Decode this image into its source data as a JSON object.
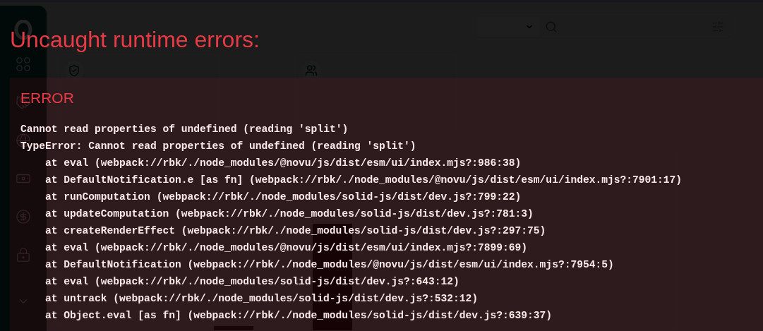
{
  "overlay": {
    "title": "Uncaught runtime errors:",
    "errors": [
      {
        "label": "ERROR",
        "message": "Cannot read properties of undefined (reading 'split')",
        "stack": [
          "TypeError: Cannot read properties of undefined (reading 'split')",
          "at eval (webpack://rbk/./node_modules/@novu/js/dist/esm/ui/index.mjs?:986:38)",
          "at DefaultNotification.e [as fn] (webpack://rbk/./node_modules/@novu/js/dist/esm/ui/index.mjs?:7901:17)",
          "at runComputation (webpack://rbk/./node_modules/solid-js/dist/dev.js?:799:22)",
          "at updateComputation (webpack://rbk/./node_modules/solid-js/dist/dev.js?:781:3)",
          "at createRenderEffect (webpack://rbk/./node_modules/solid-js/dist/dev.js?:297:75)",
          "at eval (webpack://rbk/./node_modules/@novu/js/dist/esm/ui/index.mjs?:7899:69)",
          "at DefaultNotification (webpack://rbk/./node_modules/@novu/js/dist/esm/ui/index.mjs?:7954:5)",
          "at eval (webpack://rbk/./node_modules/solid-js/dist/dev.js?:643:12)",
          "at untrack (webpack://rbk/./node_modules/solid-js/dist/dev.js?:532:12)",
          "at Object.eval [as fn] (webpack://rbk/./node_modules/solid-js/dist/dev.js?:639:37)"
        ]
      }
    ]
  }
}
